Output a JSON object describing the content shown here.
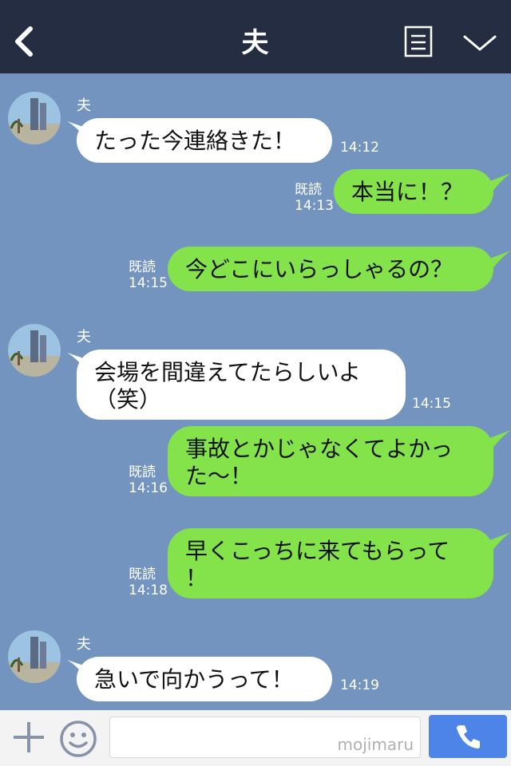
{
  "header": {
    "title": "夫",
    "back_icon": "chevron-left-icon",
    "menu_icon": "note-icon",
    "collapse_icon": "chevron-down-icon"
  },
  "messages": [
    {
      "side": "in",
      "sender": "夫",
      "text": "たった今連絡きた！",
      "time": "14:12"
    },
    {
      "side": "out",
      "read": "既読",
      "text": "本当に！？",
      "time": "14:13"
    },
    {
      "side": "out",
      "read": "既読",
      "text": "今どこにいらっしゃるの？",
      "time": "14:15"
    },
    {
      "side": "in",
      "sender": "夫",
      "line1": "会場を間違えてたらしいよ",
      "line2": "（笑）",
      "time": "14:15"
    },
    {
      "side": "out",
      "read": "既読",
      "line1": "事故とかじゃなくてよかっ",
      "line2": "た〜！",
      "time": "14:16"
    },
    {
      "side": "out",
      "read": "既読",
      "line1": "早くこっちに来てもらって",
      "line2": "！",
      "time": "14:18"
    },
    {
      "side": "in",
      "sender": "夫",
      "text": "急いで向かうって！",
      "time": "14:19"
    }
  ],
  "footer": {
    "watermark": "mojimaru",
    "add_icon": "plus-icon",
    "emoji_icon": "smiley-icon",
    "call_icon": "phone-icon"
  },
  "colors": {
    "header_bg": "#252d43",
    "chat_bg": "#7494c0",
    "outgoing_bubble": "#84e24b",
    "incoming_bubble": "#ffffff",
    "call_button": "#4c84e8"
  }
}
